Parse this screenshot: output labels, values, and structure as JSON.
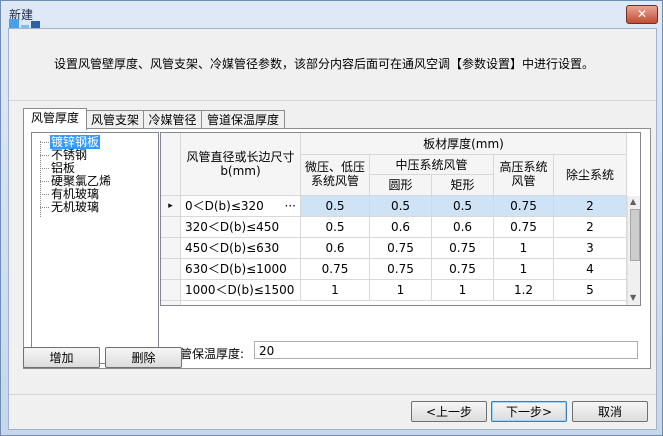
{
  "window": {
    "title": "新建",
    "close_glyph": "✕"
  },
  "description": "设置风管壁厚度、风管支架、冷媒管径参数，该部分内容后面可在通风空调【参数设置】中进行设置。",
  "tabs": [
    {
      "label": "风管厚度",
      "active": true
    },
    {
      "label": "风管支架",
      "active": false
    },
    {
      "label": "冷媒管径",
      "active": false
    },
    {
      "label": "管道保温厚度",
      "active": false
    }
  ],
  "materials": [
    {
      "label": "镀锌钢板",
      "selected": true
    },
    {
      "label": "不锈钢",
      "selected": false
    },
    {
      "label": "铝板",
      "selected": false
    },
    {
      "label": "硬聚氯乙烯",
      "selected": false
    },
    {
      "label": "有机玻璃",
      "selected": false
    },
    {
      "label": "无机玻璃",
      "selected": false
    }
  ],
  "grid": {
    "col_diameter": "风管直径或长边尺寸b(mm)",
    "col_group": "板材厚度(mm)",
    "col_lowmid": "微压、低压系统风管",
    "col_midgroup": "中压系统风管",
    "col_round": "圆形",
    "col_rect": "矩形",
    "col_high": "高压系统风管",
    "col_dust": "除尘系统",
    "row_marker": "▸",
    "ellipsis": "···",
    "rows": [
      {
        "range": "0＜D(b)≤320",
        "lowmid": "0.5",
        "round": "0.5",
        "rect": "0.5",
        "high": "0.75",
        "dust": "2"
      },
      {
        "range": "320＜D(b)≤450",
        "lowmid": "0.5",
        "round": "0.6",
        "rect": "0.6",
        "high": "0.75",
        "dust": "2"
      },
      {
        "range": "450＜D(b)≤630",
        "lowmid": "0.6",
        "round": "0.75",
        "rect": "0.75",
        "high": "1",
        "dust": "3"
      },
      {
        "range": "630＜D(b)≤1000",
        "lowmid": "0.75",
        "round": "0.75",
        "rect": "0.75",
        "high": "1",
        "dust": "4"
      },
      {
        "range": "1000＜D(b)≤1500",
        "lowmid": "1",
        "round": "1",
        "rect": "1",
        "high": "1.2",
        "dust": "5"
      }
    ]
  },
  "insulation": {
    "label": "风管保温厚度:",
    "value": "20"
  },
  "buttons": {
    "add": "增加",
    "delete": "删除",
    "prev": "<上一步",
    "next": "下一步>",
    "cancel": "取消"
  }
}
